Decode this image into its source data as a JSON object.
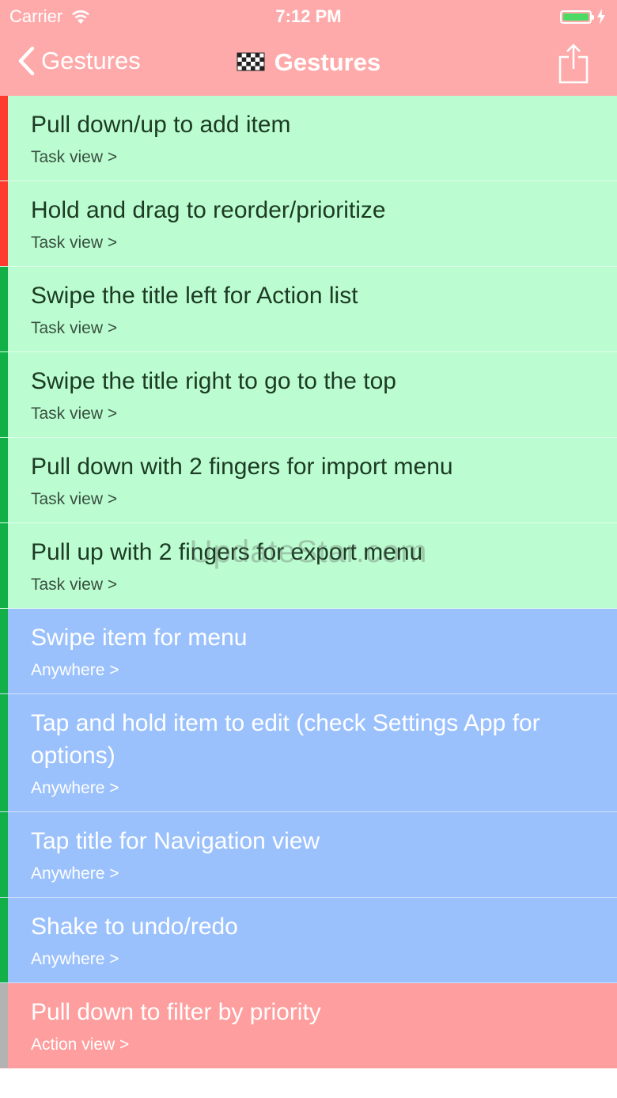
{
  "status_bar": {
    "carrier": "Carrier",
    "time": "7:12 PM",
    "battery_level": 1.0
  },
  "nav": {
    "back_label": "Gestures",
    "title": "Gestures",
    "title_icon": "checkered-flag-icon",
    "share_icon": "share-icon"
  },
  "items": [
    {
      "label": "Pull down/up to add item",
      "sub": "Task view >",
      "theme": "green",
      "marker": "#ff3b30"
    },
    {
      "label": "Hold and drag to reorder/prioritize",
      "sub": "Task view >",
      "theme": "green",
      "marker": "#ff3b30"
    },
    {
      "label": "Swipe the title left for Action list",
      "sub": "Task view >",
      "theme": "green",
      "marker": "#12b046"
    },
    {
      "label": "Swipe the title right to go to the top",
      "sub": "Task view >",
      "theme": "green",
      "marker": "#12b046"
    },
    {
      "label": "Pull down with 2 fingers for import menu",
      "sub": "Task view >",
      "theme": "green",
      "marker": "#12b046"
    },
    {
      "label": "Pull up with 2 fingers for export menu",
      "sub": "Task view >",
      "theme": "green",
      "marker": "#12b046"
    },
    {
      "label": "Swipe item for menu",
      "sub": "Anywhere >",
      "theme": "blue",
      "marker": "#12b046"
    },
    {
      "label": "Tap and hold item to edit (check Settings App for options)",
      "sub": "Anywhere >",
      "theme": "blue",
      "marker": "#12b046"
    },
    {
      "label": "Tap title for Navigation view",
      "sub": "Anywhere >",
      "theme": "blue",
      "marker": "#12b046"
    },
    {
      "label": "Shake to undo/redo",
      "sub": "Anywhere >",
      "theme": "blue",
      "marker": "#12b046"
    },
    {
      "label": "Pull down to filter by priority",
      "sub": "Action view >",
      "theme": "pink",
      "marker": "#b3b3b3"
    }
  ],
  "watermark": "UpdateStar.com",
  "colors": {
    "header": "#ffaaaa",
    "green_row": "#bbfdd0",
    "blue_row": "#9bc1fd",
    "pink_row": "#ff9e9e",
    "battery": "#4cd964"
  }
}
